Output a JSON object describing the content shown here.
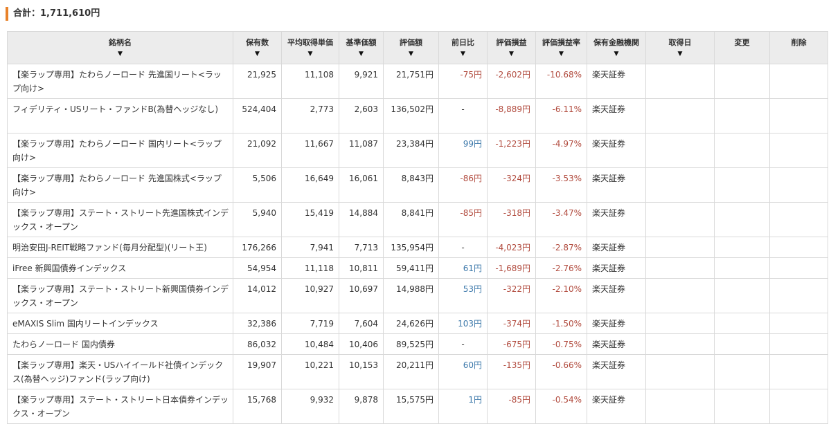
{
  "summary": {
    "label": "合計：1,711,610円"
  },
  "headers": [
    {
      "label": "銘柄名",
      "sortable": true
    },
    {
      "label": "保有数",
      "sortable": true
    },
    {
      "label": "平均取得単価",
      "sortable": true
    },
    {
      "label": "基準価額",
      "sortable": true
    },
    {
      "label": "評価額",
      "sortable": true
    },
    {
      "label": "前日比",
      "sortable": true
    },
    {
      "label": "評価損益",
      "sortable": true
    },
    {
      "label": "評価損益率",
      "sortable": true
    },
    {
      "label": "保有金融機関",
      "sortable": true
    },
    {
      "label": "取得日",
      "sortable": true
    },
    {
      "label": "変更",
      "sortable": false
    },
    {
      "label": "削除",
      "sortable": false
    }
  ],
  "sort_glyph": "▼",
  "colors": {
    "accent": "#e8822a",
    "negative": "#b14a3d",
    "positive": "#3c78aa",
    "header_bg": "#ececec"
  },
  "rows": [
    {
      "name": "【楽ラップ専用】たわらノーロード 先進国リート<ラップ向け>",
      "qty": "21,925",
      "avg": "11,108",
      "nav": "9,921",
      "value": "21,751円",
      "change": "-75円",
      "change_sign": "neg",
      "pl": "-2,602円",
      "pl_rate": "-10.68%",
      "inst": "楽天証券",
      "date": "",
      "lines": 2
    },
    {
      "name": "フィデリティ・USリート・ファンドB(為替ヘッジなし)",
      "qty": "524,404",
      "avg": "2,773",
      "nav": "2,603",
      "value": "136,502円",
      "change": "-",
      "change_sign": "zero",
      "pl": "-8,889円",
      "pl_rate": "-6.11%",
      "inst": "楽天証券",
      "date": "",
      "lines": 2
    },
    {
      "name": "【楽ラップ専用】たわらノーロード 国内リート<ラップ向け>",
      "qty": "21,092",
      "avg": "11,667",
      "nav": "11,087",
      "value": "23,384円",
      "change": "99円",
      "change_sign": "pos",
      "pl": "-1,223円",
      "pl_rate": "-4.97%",
      "inst": "楽天証券",
      "date": "",
      "lines": 2
    },
    {
      "name": "【楽ラップ専用】たわらノーロード 先進国株式<ラップ向け>",
      "qty": "5,506",
      "avg": "16,649",
      "nav": "16,061",
      "value": "8,843円",
      "change": "-86円",
      "change_sign": "neg",
      "pl": "-324円",
      "pl_rate": "-3.53%",
      "inst": "楽天証券",
      "date": "",
      "lines": 2
    },
    {
      "name": "【楽ラップ専用】ステート・ストリート先進国株式インデックス・オープン",
      "qty": "5,940",
      "avg": "15,419",
      "nav": "14,884",
      "value": "8,841円",
      "change": "-85円",
      "change_sign": "neg",
      "pl": "-318円",
      "pl_rate": "-3.47%",
      "inst": "楽天証券",
      "date": "",
      "lines": 2
    },
    {
      "name": "明治安田J-REIT戦略ファンド(毎月分配型)(リート王)",
      "qty": "176,266",
      "avg": "7,941",
      "nav": "7,713",
      "value": "135,954円",
      "change": "-",
      "change_sign": "zero",
      "pl": "-4,023円",
      "pl_rate": "-2.87%",
      "inst": "楽天証券",
      "date": "",
      "lines": 1
    },
    {
      "name": "iFree 新興国債券インデックス",
      "qty": "54,954",
      "avg": "11,118",
      "nav": "10,811",
      "value": "59,411円",
      "change": "61円",
      "change_sign": "pos",
      "pl": "-1,689円",
      "pl_rate": "-2.76%",
      "inst": "楽天証券",
      "date": "",
      "lines": 1
    },
    {
      "name": "【楽ラップ専用】ステート・ストリート新興国債券インデックス・オープン",
      "qty": "14,012",
      "avg": "10,927",
      "nav": "10,697",
      "value": "14,988円",
      "change": "53円",
      "change_sign": "pos",
      "pl": "-322円",
      "pl_rate": "-2.10%",
      "inst": "楽天証券",
      "date": "",
      "lines": 2
    },
    {
      "name": "eMAXIS Slim 国内リートインデックス",
      "qty": "32,386",
      "avg": "7,719",
      "nav": "7,604",
      "value": "24,626円",
      "change": "103円",
      "change_sign": "pos",
      "pl": "-374円",
      "pl_rate": "-1.50%",
      "inst": "楽天証券",
      "date": "",
      "lines": 1
    },
    {
      "name": "たわらノーロード 国内債券",
      "qty": "86,032",
      "avg": "10,484",
      "nav": "10,406",
      "value": "89,525円",
      "change": "-",
      "change_sign": "zero",
      "pl": "-675円",
      "pl_rate": "-0.75%",
      "inst": "楽天証券",
      "date": "",
      "lines": 1
    },
    {
      "name": "【楽ラップ専用】楽天・USハイイールド社債インデックス(為替ヘッジ)ファンド(ラップ向け)",
      "qty": "19,907",
      "avg": "10,221",
      "nav": "10,153",
      "value": "20,211円",
      "change": "60円",
      "change_sign": "pos",
      "pl": "-135円",
      "pl_rate": "-0.66%",
      "inst": "楽天証券",
      "date": "",
      "lines": 2
    },
    {
      "name": "【楽ラップ専用】ステート・ストリート日本債券インデックス・オープン",
      "qty": "15,768",
      "avg": "9,932",
      "nav": "9,878",
      "value": "15,575円",
      "change": "1円",
      "change_sign": "pos",
      "pl": "-85円",
      "pl_rate": "-0.54%",
      "inst": "楽天証券",
      "date": "",
      "lines": 2
    }
  ]
}
